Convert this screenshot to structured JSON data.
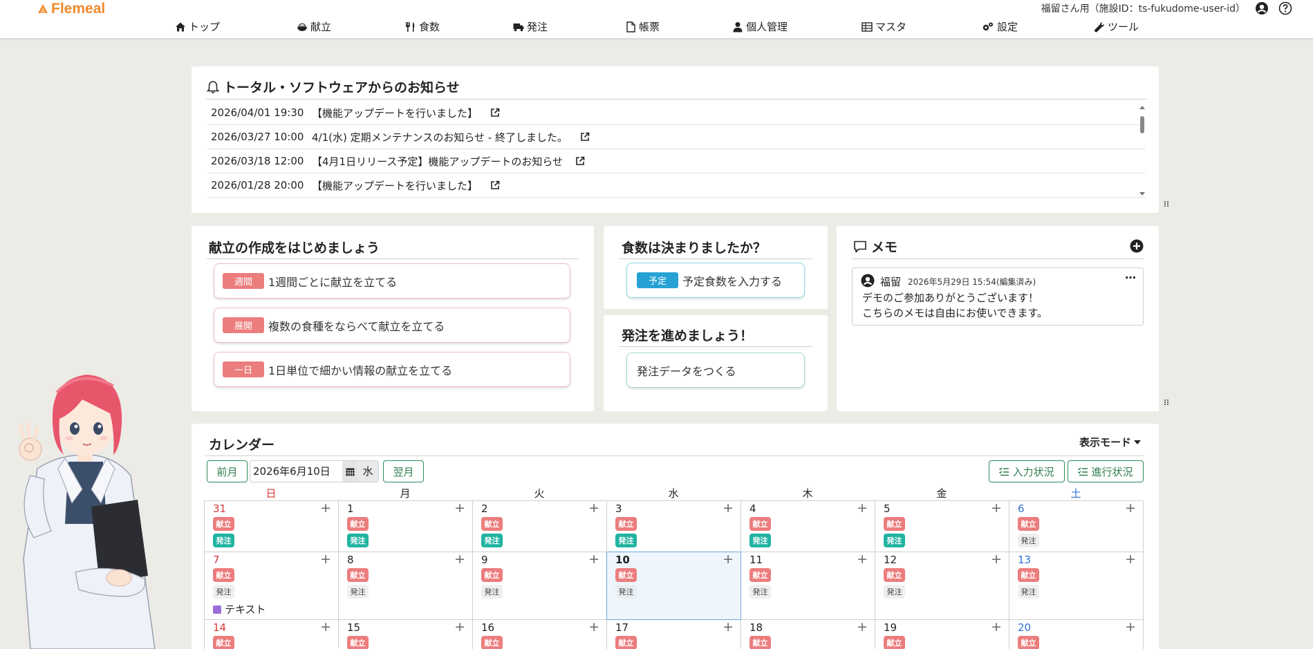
{
  "app": {
    "logo_text": "Flemeal",
    "user_label": "福留さん用（施設ID：ts-fukudome-user-id）",
    "brand_color": "#f08a2c"
  },
  "nav": [
    {
      "label": "トップ",
      "icon": "home-icon"
    },
    {
      "label": "献立",
      "icon": "rice-bowl-icon"
    },
    {
      "label": "食数",
      "icon": "utensils-icon"
    },
    {
      "label": "発注",
      "icon": "truck-icon"
    },
    {
      "label": "帳票",
      "icon": "file-icon"
    },
    {
      "label": "個人管理",
      "icon": "user-icon"
    },
    {
      "label": "マスタ",
      "icon": "table-icon"
    },
    {
      "label": "設定",
      "icon": "gears-icon"
    },
    {
      "label": "ツール",
      "icon": "wrench-icon"
    }
  ],
  "notice": {
    "title": "トータル・ソフトウェアからのお知らせ",
    "items": [
      {
        "datetime": "2026/04/01  19:30",
        "text": "【機能アップデートを行いました】"
      },
      {
        "datetime": "2026/03/27  10:00",
        "text": "4/1(水) 定期メンテナンスのお知らせ - 終了しました。"
      },
      {
        "datetime": "2026/03/18  12:00",
        "text": "【4月1日リリース予定】機能アップデートのお知らせ"
      },
      {
        "datetime": "2026/01/28  20:00",
        "text": "【機能アップデートを行いました】"
      }
    ]
  },
  "start_menu": {
    "title": "献立の作成をはじめましょう",
    "buttons": [
      {
        "tag": "週間",
        "label": "1週間ごとに献立を立てる"
      },
      {
        "tag": "展開",
        "label": "複数の食種をならべて献立を立てる"
      },
      {
        "tag": "一日",
        "label": "1日単位で細かい情報の献立を立てる"
      }
    ]
  },
  "meal_count": {
    "title": "食数は決まりましたか？",
    "tag": "予定",
    "label": "予定食数を入力する"
  },
  "order": {
    "title": "発注を進めましょう！",
    "label": "発注データをつくる"
  },
  "memo": {
    "title": "メモ",
    "entry": {
      "author": "福留",
      "timestamp": "2026年5月29日 15:54(編集済み)",
      "menu": "…",
      "line1": "デモのご参加ありがとうございます！",
      "line2": "こちらのメモは自由にお使いできます。"
    }
  },
  "calendar": {
    "title": "カレンダー",
    "view_mode": "表示モード",
    "prev": "前月",
    "next": "翌月",
    "date_value": "2026年6月10日",
    "weekday_value": "水",
    "input_status": "入力状況",
    "progress_status": "進行状況",
    "weekdays": [
      "日",
      "月",
      "火",
      "水",
      "木",
      "金",
      "土"
    ],
    "badge_kondate": "献立",
    "badge_hatchu": "発注",
    "rows": [
      [
        "31",
        "1",
        "2",
        "3",
        "4",
        "5",
        "6"
      ],
      [
        "7",
        "8",
        "9",
        "10",
        "11",
        "12",
        "13"
      ],
      [
        "14",
        "15",
        "16",
        "17",
        "18",
        "19",
        "20"
      ]
    ],
    "event_text": "テキスト",
    "event_color": "#9b6fd6"
  }
}
